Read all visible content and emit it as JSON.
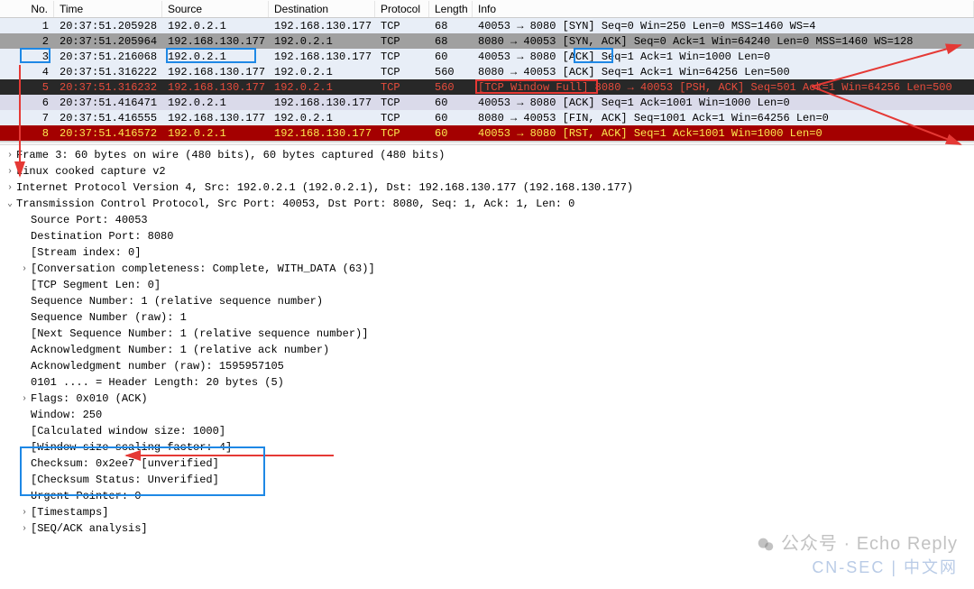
{
  "columns": {
    "no": "No.",
    "time": "Time",
    "source": "Source",
    "destination": "Destination",
    "protocol": "Protocol",
    "length": "Length",
    "info": "Info"
  },
  "packets": [
    {
      "no": "1",
      "time": "20:37:51.205928",
      "src": "192.0.2.1",
      "dst": "192.168.130.177",
      "proto": "TCP",
      "len": "68",
      "info": "40053 → 8080 [SYN] Seq=0 Win=250 Len=0 MSS=1460 WS=4",
      "cls": "row-light"
    },
    {
      "no": "2",
      "time": "20:37:51.205964",
      "src": "192.168.130.177",
      "dst": "192.0.2.1",
      "proto": "TCP",
      "len": "68",
      "info": "8080 → 40053 [SYN, ACK] Seq=0 Ack=1 Win=64240 Len=0 MSS=1460 WS=128",
      "cls": "row-gray"
    },
    {
      "no": "3",
      "time": "20:37:51.216068",
      "src": "192.0.2.1",
      "dst": "192.168.130.177",
      "proto": "TCP",
      "len": "60",
      "info": "40053 → 8080 [ACK] Seq=1 Ack=1 Win=1000 Len=0",
      "cls": "row-light"
    },
    {
      "no": "4",
      "time": "20:37:51.316222",
      "src": "192.168.130.177",
      "dst": "192.0.2.1",
      "proto": "TCP",
      "len": "560",
      "info": "8080 → 40053 [ACK] Seq=1 Ack=1 Win=64256 Len=500",
      "cls": "row-light"
    },
    {
      "no": "5",
      "time": "20:37:51.316232",
      "src": "192.168.130.177",
      "dst": "192.0.2.1",
      "proto": "TCP",
      "len": "560",
      "info": "[TCP Window Full] 8080 → 40053 [PSH, ACK] Seq=501 Ack=1 Win=64256 Len=500",
      "cls": "row-dark"
    },
    {
      "no": "6",
      "time": "20:37:51.416471",
      "src": "192.0.2.1",
      "dst": "192.168.130.177",
      "proto": "TCP",
      "len": "60",
      "info": "40053 → 8080 [ACK] Seq=1 Ack=1001 Win=1000 Len=0",
      "cls": "row-lav"
    },
    {
      "no": "7",
      "time": "20:37:51.416555",
      "src": "192.168.130.177",
      "dst": "192.0.2.1",
      "proto": "TCP",
      "len": "60",
      "info": "8080 → 40053 [FIN, ACK] Seq=1001 Ack=1 Win=64256 Len=0",
      "cls": "row-light"
    },
    {
      "no": "8",
      "time": "20:37:51.416572",
      "src": "192.0.2.1",
      "dst": "192.168.130.177",
      "proto": "TCP",
      "len": "60",
      "info": "40053 → 8080 [RST, ACK] Seq=1 Ack=1001 Win=1000 Len=0",
      "cls": "row-red"
    }
  ],
  "details": {
    "frame": "Frame 3: 60 bytes on wire (480 bits), 60 bytes captured (480 bits)",
    "linux": "Linux cooked capture v2",
    "ip": "Internet Protocol Version 4, Src: 192.0.2.1 (192.0.2.1), Dst: 192.168.130.177 (192.168.130.177)",
    "tcp": "Transmission Control Protocol, Src Port: 40053, Dst Port: 8080, Seq: 1, Ack: 1, Len: 0",
    "srcport": "Source Port: 40053",
    "dstport": "Destination Port: 8080",
    "stream": "[Stream index: 0]",
    "conv": "[Conversation completeness: Complete, WITH_DATA (63)]",
    "seglen": "[TCP Segment Len: 0]",
    "seqnum": "Sequence Number: 1    (relative sequence number)",
    "seqraw": "Sequence Number (raw): 1",
    "nextseq": "[Next Sequence Number: 1    (relative sequence number)]",
    "acknum": "Acknowledgment Number: 1    (relative ack number)",
    "ackraw": "Acknowledgment number (raw): 1595957105",
    "hdrlen": "0101 .... = Header Length: 20 bytes (5)",
    "flags": "Flags: 0x010 (ACK)",
    "window": "Window: 250",
    "calcwin": "[Calculated window size: 1000]",
    "scalefac": "[Window size scaling factor: 4]",
    "checksum": "Checksum: 0x2ee7 [unverified]",
    "chkstatus": "[Checksum Status: Unverified]",
    "urgent": "Urgent Pointer: 0",
    "timestamps": "[Timestamps]",
    "seqack": "[SEQ/ACK analysis]"
  },
  "watermark": {
    "line1": "公众号 · Echo Reply",
    "line2": "CN-SEC | 中文网"
  }
}
